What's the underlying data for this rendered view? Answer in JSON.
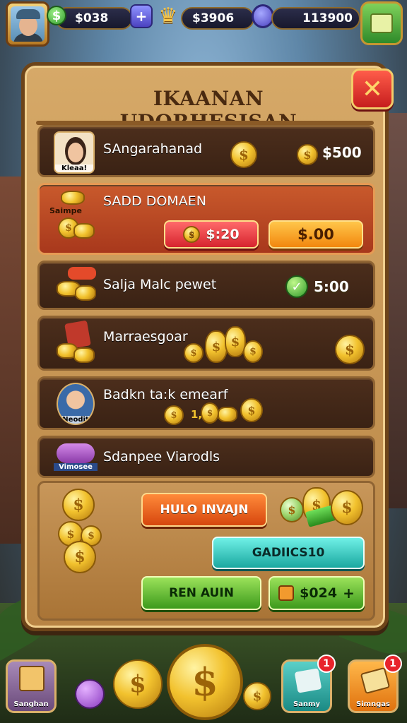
{
  "hud": {
    "money_value": "$038",
    "trophy_value": "$3906",
    "gem_value": "113900"
  },
  "panel": {
    "title": "IKAANAN UDORHESISAN",
    "close_symbol": "✕"
  },
  "rows": [
    {
      "label": "SAngarahanad",
      "portrait_caption": "Kleaa!",
      "price": "$500"
    },
    {
      "label": "SADD DOMAEN",
      "icon_caption": "Saimpe",
      "red_button": "$:20",
      "orange_button": "$.00"
    },
    {
      "label": "Salja Malc pewet",
      "price": "5:00"
    },
    {
      "label": "Marraesgoar"
    },
    {
      "label": "Badkn ta:k emearf",
      "portrait_caption": "Neodit",
      "coin_text": "1,"
    },
    {
      "label": "Sdanpee Viarodls",
      "icon_caption": "Vimosee"
    }
  ],
  "rewards": {
    "hulo_button": "HULO INVAJN",
    "teal_button": "GADIICS10",
    "green_button": "REN AUIN",
    "green_price_button": "$024"
  },
  "bottom_nav": [
    {
      "label": "Sanghan"
    },
    {
      "label": "Sanmy",
      "badge": "1"
    },
    {
      "label": "Simngas",
      "badge": "1"
    }
  ],
  "colors": {
    "panel": "#c8975a",
    "accent_red": "#d6242e",
    "accent_orange": "#f2870e",
    "accent_teal": "#1aa8a0",
    "accent_green": "#3d9a1c"
  }
}
